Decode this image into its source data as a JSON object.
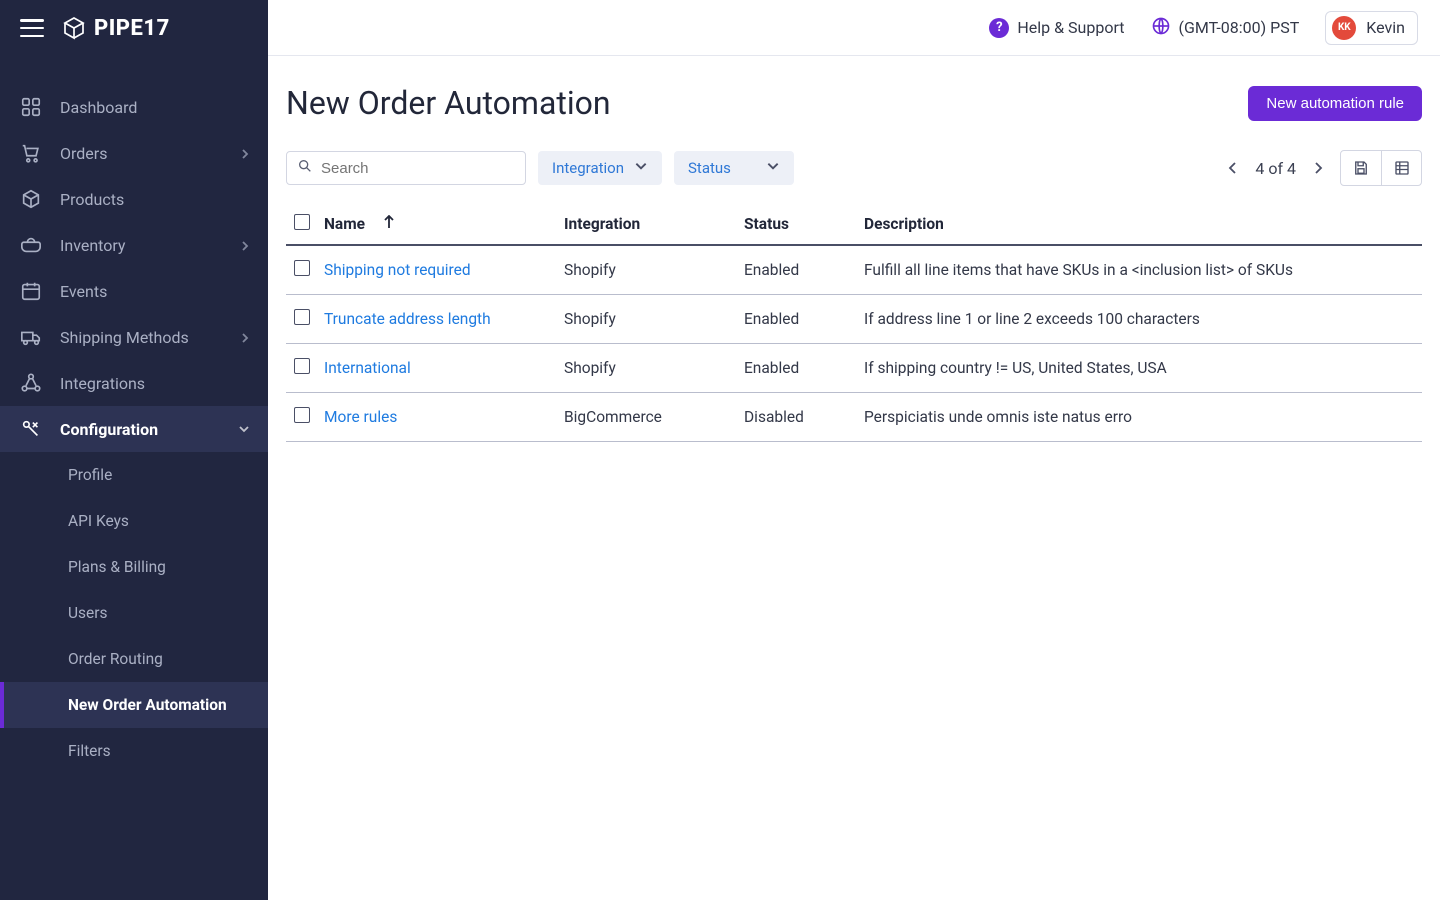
{
  "brand": {
    "name": "PIPE17"
  },
  "header": {
    "help_label": "Help & Support",
    "timezone_label": "(GMT-08:00) PST",
    "user_initials": "KK",
    "user_name": "Kevin"
  },
  "sidebar": {
    "items": [
      {
        "icon": "dashboard",
        "label": "Dashboard"
      },
      {
        "icon": "cart",
        "label": "Orders",
        "expandable": true
      },
      {
        "icon": "box",
        "label": "Products"
      },
      {
        "icon": "tray",
        "label": "Inventory",
        "expandable": true
      },
      {
        "icon": "calendar",
        "label": "Events"
      },
      {
        "icon": "truck",
        "label": "Shipping Methods",
        "expandable": true
      },
      {
        "icon": "nodes",
        "label": "Integrations"
      },
      {
        "icon": "wrench",
        "label": "Configuration",
        "expandable": true,
        "active": true
      }
    ],
    "config_children": [
      {
        "label": "Profile"
      },
      {
        "label": "API Keys"
      },
      {
        "label": "Plans & Billing"
      },
      {
        "label": "Users"
      },
      {
        "label": "Order Routing"
      },
      {
        "label": "New Order Automation",
        "active": true
      },
      {
        "label": "Filters"
      }
    ]
  },
  "page": {
    "title": "New Order Automation",
    "primary_button_label": "New automation rule"
  },
  "toolbar": {
    "search_placeholder": "Search",
    "filter_integration_label": "Integration",
    "filter_status_label": "Status",
    "pager_label": "4 of 4"
  },
  "table": {
    "columns": {
      "name": "Name",
      "integration": "Integration",
      "status": "Status",
      "description": "Description"
    },
    "rows": [
      {
        "name": "Shipping not required",
        "integration": "Shopify",
        "status": "Enabled",
        "description": "Fulfill all line items that have SKUs in a <inclusion list> of SKUs"
      },
      {
        "name": "Truncate address length",
        "integration": "Shopify",
        "status": "Enabled",
        "description": "If address line 1 or line 2 exceeds 100 characters"
      },
      {
        "name": "International",
        "integration": "Shopify",
        "status": "Enabled",
        "description": "If shipping country != US, United States, USA"
      },
      {
        "name": "More rules",
        "integration": "BigCommerce",
        "status": "Disabled",
        "description": "Perspiciatis unde omnis iste natus erro"
      }
    ]
  },
  "colors": {
    "accent": "#6b2bd6",
    "link": "#1f7be0",
    "sidebar_bg": "#212640"
  }
}
